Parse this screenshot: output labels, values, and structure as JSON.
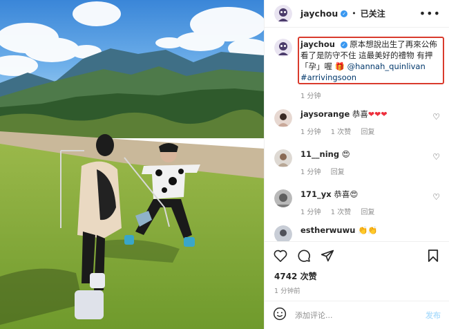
{
  "header": {
    "username": "jaychou",
    "follow_status": "已关注",
    "more": "•••"
  },
  "caption": {
    "username": "jaychou",
    "text": "原本想說出生了再來公佈 看了是防守不住 這最美好的禮物 有押「孕」喔",
    "mention": "@hannah_quinlivan",
    "hashtag": "#arrivingsoon",
    "time": "1 分钟"
  },
  "comments": [
    {
      "username": "jaysorange",
      "text": "恭喜",
      "emoji": "❤❤❤",
      "time": "1 分钟",
      "likes": "1 次赞",
      "reply": "回复"
    },
    {
      "username": "11__ning",
      "text": "",
      "emoji": "😍",
      "time": "1 分钟",
      "likes": "",
      "reply": "回复"
    },
    {
      "username": "171_yx",
      "text": "恭喜",
      "emoji": "😍",
      "time": "1 分钟",
      "likes": "1 次赞",
      "reply": "回复"
    },
    {
      "username": "estherwuwu",
      "text": "",
      "emoji": "👏👏",
      "time": "",
      "likes": "",
      "reply": ""
    }
  ],
  "likes": "4742 次赞",
  "posted_time": "1 分钟前",
  "comment_box": {
    "placeholder": "添加评论...",
    "post_label": "发布"
  },
  "colors": {
    "highlight_box": "#d93a2c",
    "link": "#00376b",
    "verified": "#3897f0",
    "muted_text": "#8e8e8e"
  },
  "icons": [
    "verified-icon",
    "more-icon",
    "heart-icon",
    "comment-icon",
    "share-icon",
    "bookmark-icon",
    "emoji-icon"
  ]
}
